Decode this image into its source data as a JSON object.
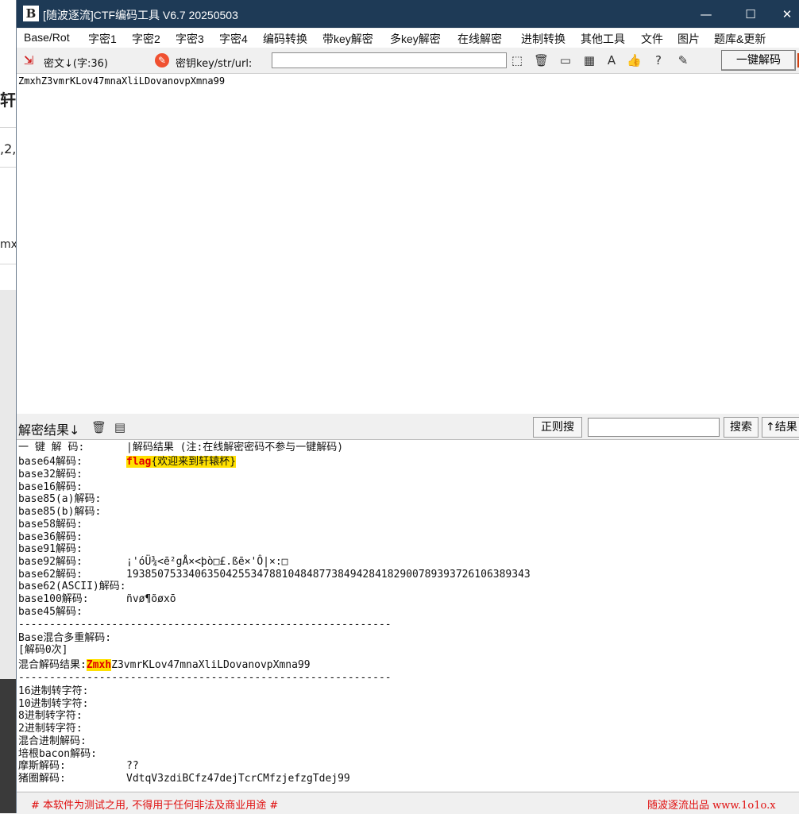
{
  "background_window": {
    "frag1": "轩",
    "frag2": ",2,",
    "frag3": "mx"
  },
  "window": {
    "title": "[随波逐流]CTF编码工具 V6.7  20250503",
    "logo": "B",
    "minimize": "—",
    "maximize": "☐",
    "close": "✕"
  },
  "menu": [
    "Base/Rot",
    "字密1",
    "字密2",
    "字密3",
    "字密4",
    "编码转换",
    "带key解密",
    "多key解密",
    "在线解密",
    "进制转换",
    "其他工具",
    "文件",
    "图片",
    "题库&更新"
  ],
  "toolbar": {
    "cipher_label": "密文↓(字:36)",
    "key_label": "密钥key/str/url:",
    "key_value": "",
    "one_click_decode": "一键解码"
  },
  "cipher_text": "ZmxhZ3vmrKLov47mnaXliLDovanovpXmna99",
  "result_bar": {
    "label": "解密结果↓",
    "regex_button": "正则搜",
    "search_value": "",
    "search_button": "搜索",
    "result_button": "↑结果"
  },
  "results": {
    "header_label": "一 键 解 码:",
    "header_value": "|解码结果 (注:在线解密密码不参与一键解码)",
    "base64_label": "base64解码:",
    "base64_flag": "flag",
    "base64_rest": "{欢迎来到轩辕杯}",
    "rows1": [
      {
        "label": "base32解码:",
        "value": ""
      },
      {
        "label": "base16解码:",
        "value": ""
      },
      {
        "label": "base85(a)解码:",
        "value": ""
      },
      {
        "label": "base85(b)解码:",
        "value": ""
      },
      {
        "label": "base58解码:",
        "value": ""
      },
      {
        "label": "base36解码:",
        "value": ""
      },
      {
        "label": "base91解码:",
        "value": ""
      },
      {
        "label": "base92解码:",
        "value": "¡'óÜ¾<ē²gÅ×<þò□£.ßē×'Ô|×:□"
      },
      {
        "label": "base62解码:",
        "value": "19385075334063504255347881048487738494284182900789393726106389343"
      },
      {
        "label": "base62(ASCII)解码:",
        "value": ""
      },
      {
        "label": "base100解码:",
        "value": "ñvø¶õøxō"
      },
      {
        "label": "base45解码:",
        "value": ""
      }
    ],
    "divider": "------------------------------------------------------------",
    "mixed_title": "Base混合多重解码:",
    "mixed_count": "[解码0次]",
    "mixed_result_label": "混合解码结果:",
    "mixed_result_hl": "Zmxh",
    "mixed_result_rest": "Z3vmrKLov47mnaXliLDovanovpXmna99",
    "rows2": [
      {
        "label": "16进制转字符:",
        "value": ""
      },
      {
        "label": "10进制转字符:",
        "value": ""
      },
      {
        "label": "8进制转字符:",
        "value": ""
      },
      {
        "label": "2进制转字符:",
        "value": ""
      },
      {
        "label": "混合进制解码:",
        "value": ""
      },
      {
        "label": "培根bacon解码:",
        "value": ""
      },
      {
        "label": "摩斯解码:",
        "value": "??"
      },
      {
        "label": "猪圈解码:",
        "value": "VdtqV3zdiBCfz47dejTcrCMfzjefzgTdej99"
      }
    ]
  },
  "status": {
    "left": "# 本软件为测试之用, 不得用于任何非法及商业用途 #",
    "right": "随波逐流出品 www.1o1o.x"
  },
  "colors": {
    "titlebar": "#1e3a56",
    "highlight": "#ffe000",
    "status_text": "#e01010"
  }
}
